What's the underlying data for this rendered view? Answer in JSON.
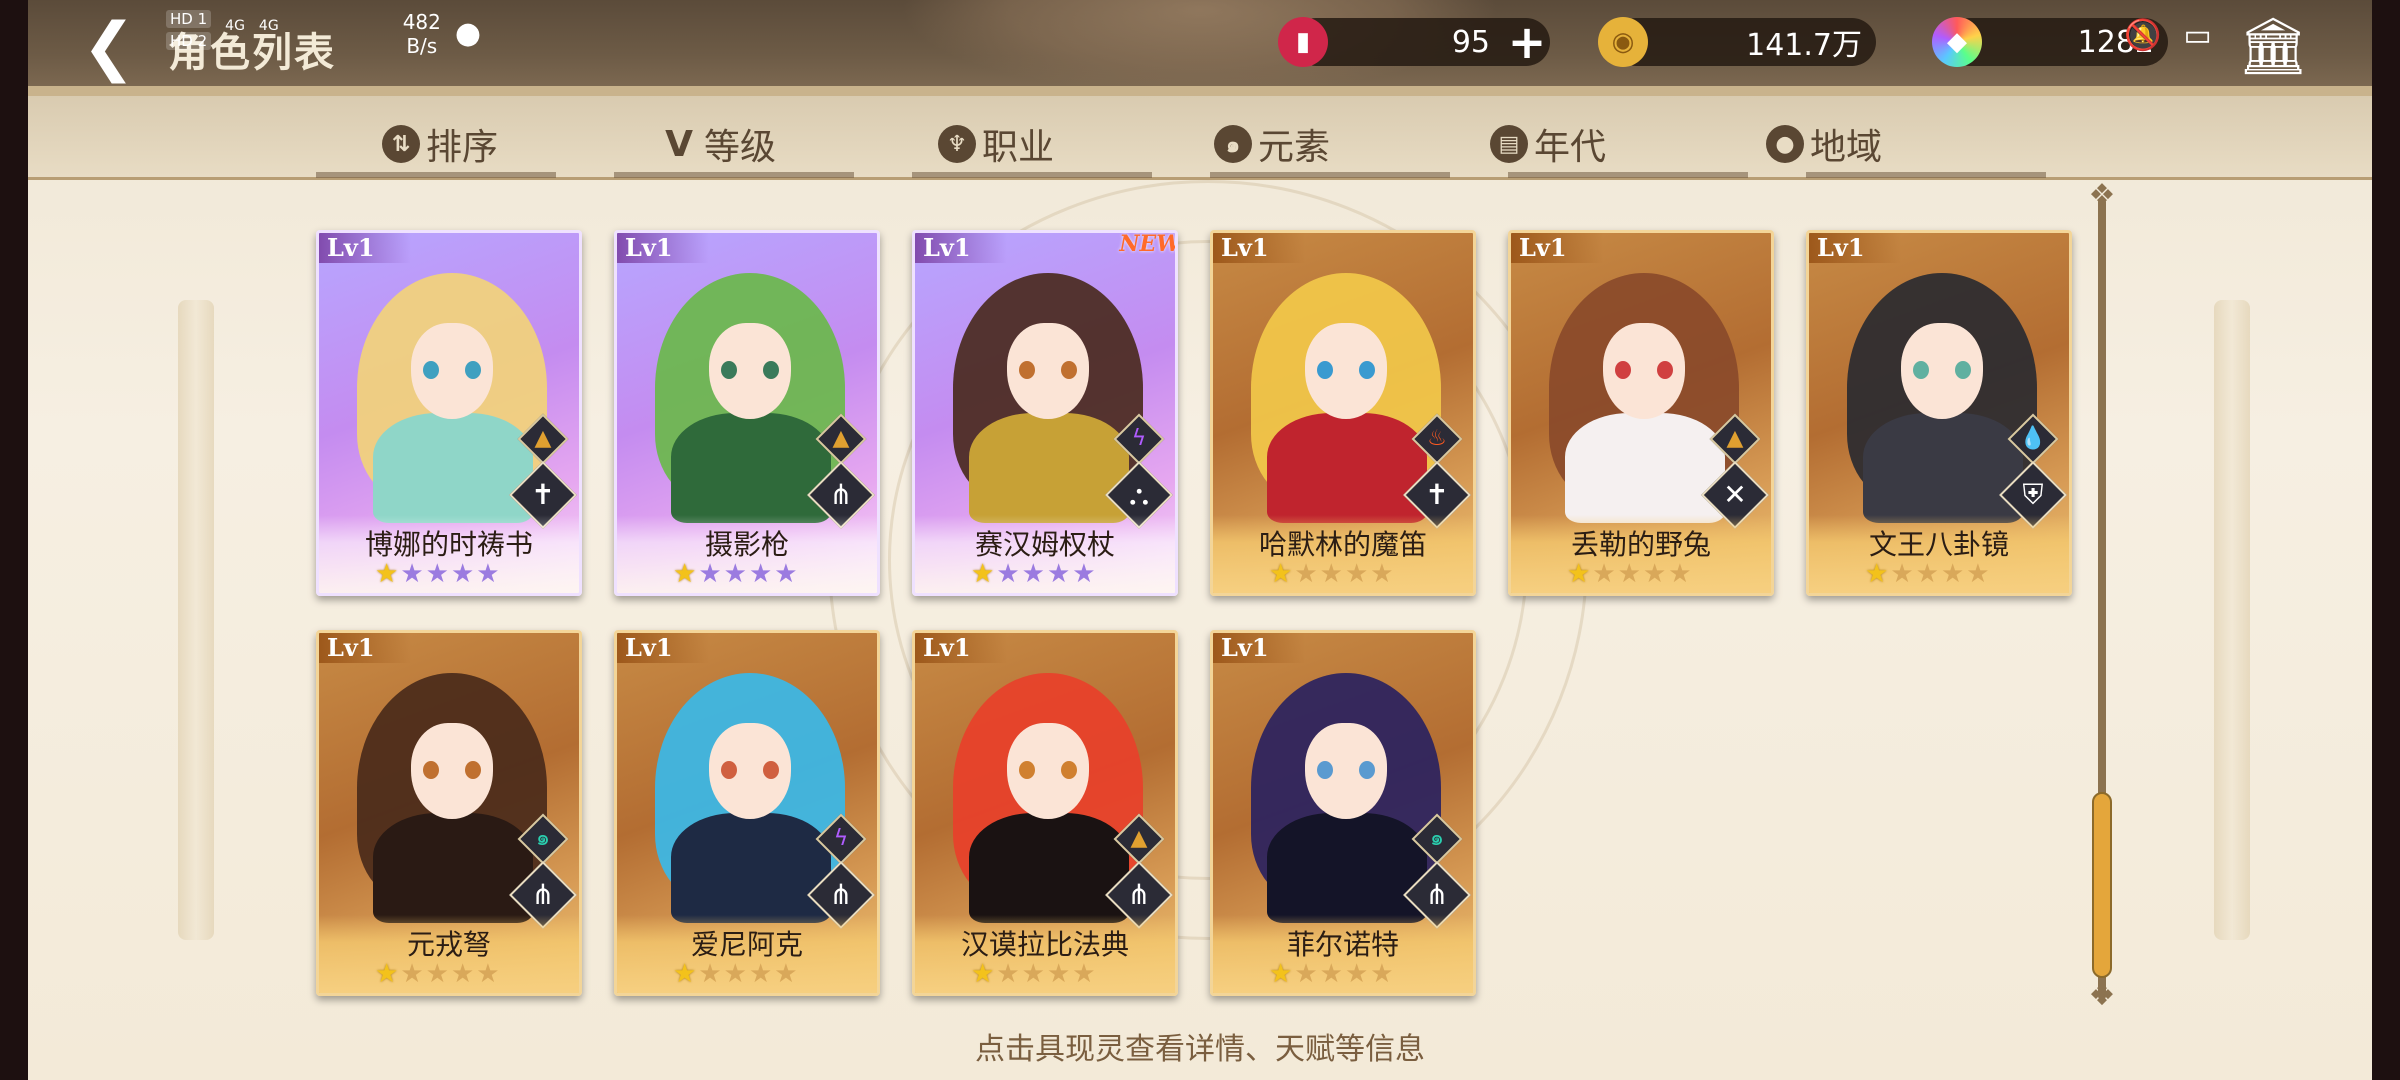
{
  "header": {
    "title": "角色列表",
    "status": {
      "hd1": "HD 1",
      "hd2": "HD 2",
      "net1": "4G",
      "net2": "4G",
      "speed_value": "482",
      "speed_unit": "B/s"
    }
  },
  "currencies": [
    {
      "name": "stamina",
      "icon": "red-can-icon",
      "value": "95",
      "has_plus": true,
      "color": "#d0264a"
    },
    {
      "name": "gold",
      "icon": "gold-coin-icon",
      "value": "141.7万",
      "has_plus": false,
      "color": "#e6b23a"
    },
    {
      "name": "crystal",
      "icon": "rainbow-crystal-icon",
      "value": "1282",
      "has_plus": false,
      "color": "#9b6bff"
    }
  ],
  "tabs": [
    {
      "label": "排序",
      "icon": "sort-icon",
      "glyph": "⇅"
    },
    {
      "label": "等级",
      "icon": "level-v-icon",
      "glyph": "V"
    },
    {
      "label": "职业",
      "icon": "class-icon",
      "glyph": "♆"
    },
    {
      "label": "元素",
      "icon": "element-swirl-icon",
      "glyph": "๑"
    },
    {
      "label": "年代",
      "icon": "era-icon",
      "glyph": "▤"
    },
    {
      "label": "地域",
      "icon": "location-pin-icon",
      "glyph": "●"
    }
  ],
  "cards": [
    {
      "name": "博娜的时祷书",
      "level": "Lv1",
      "rarity": "purple",
      "stars": 1,
      "max_stars": 5,
      "element": "earth",
      "element_color": "#e0a030",
      "element_glyph": "▲",
      "job_glyph": "✝",
      "is_new": false,
      "hair": "#f2d27a",
      "outfit": "#8fd6c8",
      "eye": "#3fa0c0"
    },
    {
      "name": "摄影枪",
      "level": "Lv1",
      "rarity": "purple",
      "stars": 1,
      "max_stars": 5,
      "element": "earth",
      "element_color": "#e0a030",
      "element_glyph": "▲",
      "job_glyph": "⋔",
      "is_new": false,
      "hair": "#6ab84b",
      "outfit": "#2f6a3a",
      "eye": "#3a7a5a"
    },
    {
      "name": "赛汉姆权杖",
      "level": "Lv1",
      "rarity": "purple",
      "stars": 1,
      "max_stars": 5,
      "element": "thunder",
      "element_color": "#b05cff",
      "element_glyph": "ϟ",
      "job_glyph": "⛬",
      "is_new": true,
      "new_label": "NEW",
      "hair": "#4a2a1e",
      "outfit": "#c7a136",
      "eye": "#c07030"
    },
    {
      "name": "哈默林的魔笛",
      "level": "Lv1",
      "rarity": "gold",
      "stars": 1,
      "max_stars": 5,
      "element": "fire",
      "element_color": "#ff5a20",
      "element_glyph": "♨",
      "job_glyph": "✝",
      "is_new": false,
      "hair": "#f2c84a",
      "outfit": "#c0242e",
      "eye": "#3a9ad0"
    },
    {
      "name": "丢勒的野兔",
      "level": "Lv1",
      "rarity": "gold",
      "stars": 1,
      "max_stars": 5,
      "element": "earth",
      "element_color": "#e0a030",
      "element_glyph": "▲",
      "job_glyph": "✕",
      "is_new": false,
      "hair": "#8a4a2a",
      "outfit": "#f5f0f0",
      "eye": "#d04040"
    },
    {
      "name": "文王八卦镜",
      "level": "Lv1",
      "rarity": "gold",
      "stars": 1,
      "max_stars": 5,
      "element": "water",
      "element_color": "#2aa0ff",
      "element_glyph": "💧",
      "job_glyph": "⛨",
      "is_new": false,
      "hair": "#2a2a30",
      "outfit": "#3a3a44",
      "eye": "#60b0a0"
    },
    {
      "name": "元戎弩",
      "level": "Lv1",
      "rarity": "gold",
      "stars": 1,
      "max_stars": 5,
      "element": "wind",
      "element_color": "#2ad0b0",
      "element_glyph": "๑",
      "job_glyph": "⋔",
      "is_new": false,
      "hair": "#4a2a1a",
      "outfit": "#2a1a14",
      "eye": "#c07030"
    },
    {
      "name": "爱尼阿克",
      "level": "Lv1",
      "rarity": "gold",
      "stars": 1,
      "max_stars": 5,
      "element": "thunder",
      "element_color": "#b05cff",
      "element_glyph": "ϟ",
      "job_glyph": "⋔",
      "is_new": false,
      "hair": "#3ab8e8",
      "outfit": "#1e2a44",
      "eye": "#d06040"
    },
    {
      "name": "汉谟拉比法典",
      "level": "Lv1",
      "rarity": "gold",
      "stars": 1,
      "max_stars": 5,
      "element": "earth",
      "element_color": "#e0a030",
      "element_glyph": "▲",
      "job_glyph": "⋔",
      "is_new": false,
      "hair": "#e8402a",
      "outfit": "#1a1212",
      "eye": "#d08030"
    },
    {
      "name": "菲尔诺特",
      "level": "Lv1",
      "rarity": "gold",
      "stars": 1,
      "max_stars": 5,
      "element": "wind",
      "element_color": "#2ad0b0",
      "element_glyph": "๑",
      "job_glyph": "⋔",
      "is_new": false,
      "hair": "#2a2260",
      "outfit": "#141428",
      "eye": "#5a9ad0"
    }
  ],
  "hint": "点击具现灵查看详情、天赋等信息"
}
